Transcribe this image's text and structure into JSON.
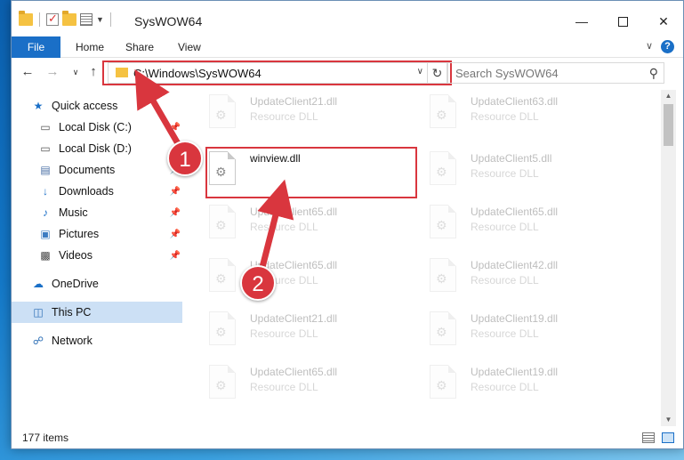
{
  "window": {
    "title": "SysWOW64"
  },
  "ribbon": {
    "tabs": [
      {
        "label": "File"
      },
      {
        "label": "Home"
      },
      {
        "label": "Share"
      },
      {
        "label": "View"
      }
    ],
    "help": "?"
  },
  "address": {
    "path": "C:\\Windows\\SysWOW64"
  },
  "search": {
    "placeholder": "Search SysWOW64"
  },
  "sidebar": {
    "items": [
      {
        "label": "Quick access",
        "icon": "star-icon"
      },
      {
        "label": "Local Disk (C:)",
        "icon": "drive-icon",
        "pinned": true
      },
      {
        "label": "Local Disk (D:)",
        "icon": "drive-icon"
      },
      {
        "label": "Documents",
        "icon": "documents-icon",
        "pinned": true
      },
      {
        "label": "Downloads",
        "icon": "download-icon",
        "pinned": true
      },
      {
        "label": "Music",
        "icon": "music-icon",
        "pinned": true
      },
      {
        "label": "Pictures",
        "icon": "pictures-icon",
        "pinned": true
      },
      {
        "label": "Videos",
        "icon": "videos-icon",
        "pinned": true
      },
      {
        "label": "OneDrive",
        "icon": "cloud-icon"
      },
      {
        "label": "This PC",
        "icon": "computer-icon",
        "selected": true
      },
      {
        "label": "Network",
        "icon": "network-icon"
      }
    ]
  },
  "files": {
    "left": [
      {
        "name": "UpdateClient21.dll",
        "type": "Resource DLL"
      },
      {
        "name": "winview.dll",
        "type": ""
      },
      {
        "name": "UpdateClient65.dll",
        "type": "Resource DLL"
      },
      {
        "name": "UpdateClient65.dll",
        "type": "Resource DLL"
      },
      {
        "name": "UpdateClient21.dll",
        "type": "Resource DLL"
      },
      {
        "name": "UpdateClient65.dll",
        "type": "Resource DLL"
      }
    ],
    "right": [
      {
        "name": "UpdateClient63.dll",
        "type": "Resource DLL"
      },
      {
        "name": "UpdateClient5.dll",
        "type": "Resource DLL"
      },
      {
        "name": "UpdateClient65.dll",
        "type": "Resource DLL"
      },
      {
        "name": "UpdateClient42.dll",
        "type": "Resource DLL"
      },
      {
        "name": "UpdateClient19.dll",
        "type": "Resource DLL"
      },
      {
        "name": "UpdateClient19.dll",
        "type": "Resource DLL"
      }
    ]
  },
  "status": {
    "item_count": "177 items"
  },
  "callouts": {
    "one": "1",
    "two": "2"
  },
  "colors": {
    "accent": "#1a6fc7",
    "callout": "#d9363e",
    "selection": "#cce0f5"
  }
}
